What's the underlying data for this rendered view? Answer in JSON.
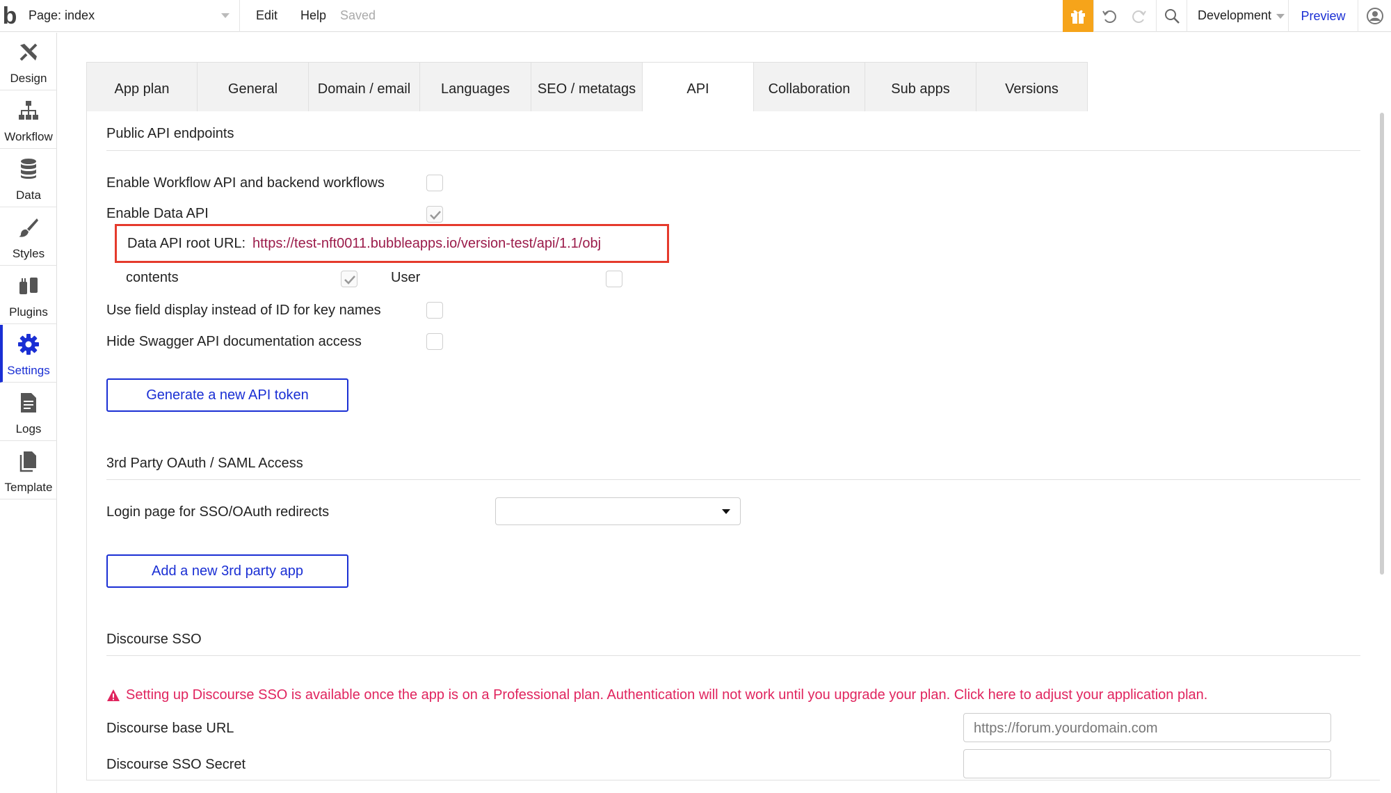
{
  "topbar": {
    "logo": "b",
    "page_label": "Page: index",
    "menu": [
      "Edit",
      "Help"
    ],
    "saved_status": "Saved",
    "environment": "Development",
    "preview": "Preview",
    "accent_color": "#f6a41a"
  },
  "sidebar": {
    "items": [
      {
        "label": "Design",
        "icon": "design-icon"
      },
      {
        "label": "Workflow",
        "icon": "workflow-icon"
      },
      {
        "label": "Data",
        "icon": "database-icon"
      },
      {
        "label": "Styles",
        "icon": "brush-icon"
      },
      {
        "label": "Plugins",
        "icon": "plugin-icon"
      },
      {
        "label": "Settings",
        "icon": "gear-icon"
      },
      {
        "label": "Logs",
        "icon": "document-icon"
      },
      {
        "label": "Template",
        "icon": "template-icon"
      }
    ],
    "active": "Settings",
    "active_color": "#1a2fd4"
  },
  "tabs": [
    "App plan",
    "General",
    "Domain / email",
    "Languages",
    "SEO / metatags",
    "API",
    "Collaboration",
    "Sub apps",
    "Versions"
  ],
  "active_tab": "API",
  "api": {
    "section_title": "Public API endpoints",
    "enable_workflow_label": "Enable Workflow API and backend workflows",
    "enable_workflow_checked": false,
    "enable_data_label": "Enable Data API",
    "enable_data_checked": true,
    "root_url_label": "Data API root URL:",
    "root_url": "https://test-nft0011.bubbleapps.io/version-test/api/1.1/obj",
    "types": [
      {
        "label": "contents",
        "checked": true
      },
      {
        "label": "User",
        "checked": false
      }
    ],
    "field_display_label": "Use field display instead of ID for key names",
    "field_display_checked": false,
    "hide_swagger_label": "Hide Swagger API documentation access",
    "hide_swagger_checked": false,
    "generate_token_button": "Generate a new API token"
  },
  "oauth": {
    "section_title": "3rd Party OAuth / SAML Access",
    "login_page_label": "Login page for SSO/OAuth redirects",
    "login_page_value": "",
    "add_app_button": "Add a new 3rd party app"
  },
  "discourse": {
    "section_title": "Discourse SSO",
    "warning": "Setting up Discourse SSO is available once the app is on a Professional plan. Authentication will not work until you upgrade your plan. Click here to adjust your application plan.",
    "warning_color": "#e0245e",
    "base_url_label": "Discourse base URL",
    "base_url_placeholder": "https://forum.yourdomain.com",
    "secret_label": "Discourse SSO Secret",
    "secret_value": ""
  }
}
